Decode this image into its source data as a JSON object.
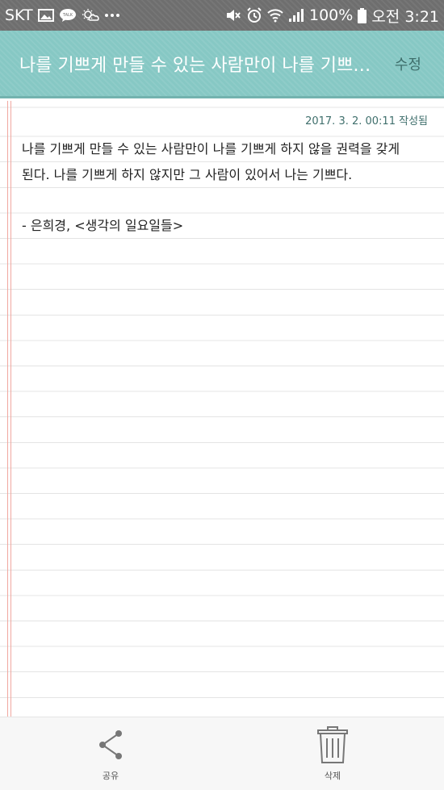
{
  "status_bar": {
    "carrier": "SKT",
    "battery": "100%",
    "time": "오전 3:21"
  },
  "header": {
    "title": "나를 기쁘게 만들 수 있는 사람만이 나를 기쁘게 하지 않을 권력을 갖게 된다. 나를 기쁘게 하지 않지만 그 사람이 있어서 나는 기쁘다.",
    "edit_label": "수정"
  },
  "memo": {
    "timestamp": "2017. 3. 2. 00:11 작성됨",
    "lines": [
      "나를 기쁘게 만들 수 있는 사람만이 나를 기쁘게 하지 않을 권력을 갖게",
      "된다. 나를 기쁘게 하지 않지만 그 사람이 있어서 나는 기쁘다.",
      "",
      "- 은희경, <생각의 일요일들>"
    ]
  },
  "toolbar": {
    "share_label": "공유",
    "delete_label": "삭제"
  },
  "colors": {
    "header_bg": "#86c8c4",
    "accent_text": "#3f6f6c",
    "margin_line": "#f0a8a0"
  }
}
